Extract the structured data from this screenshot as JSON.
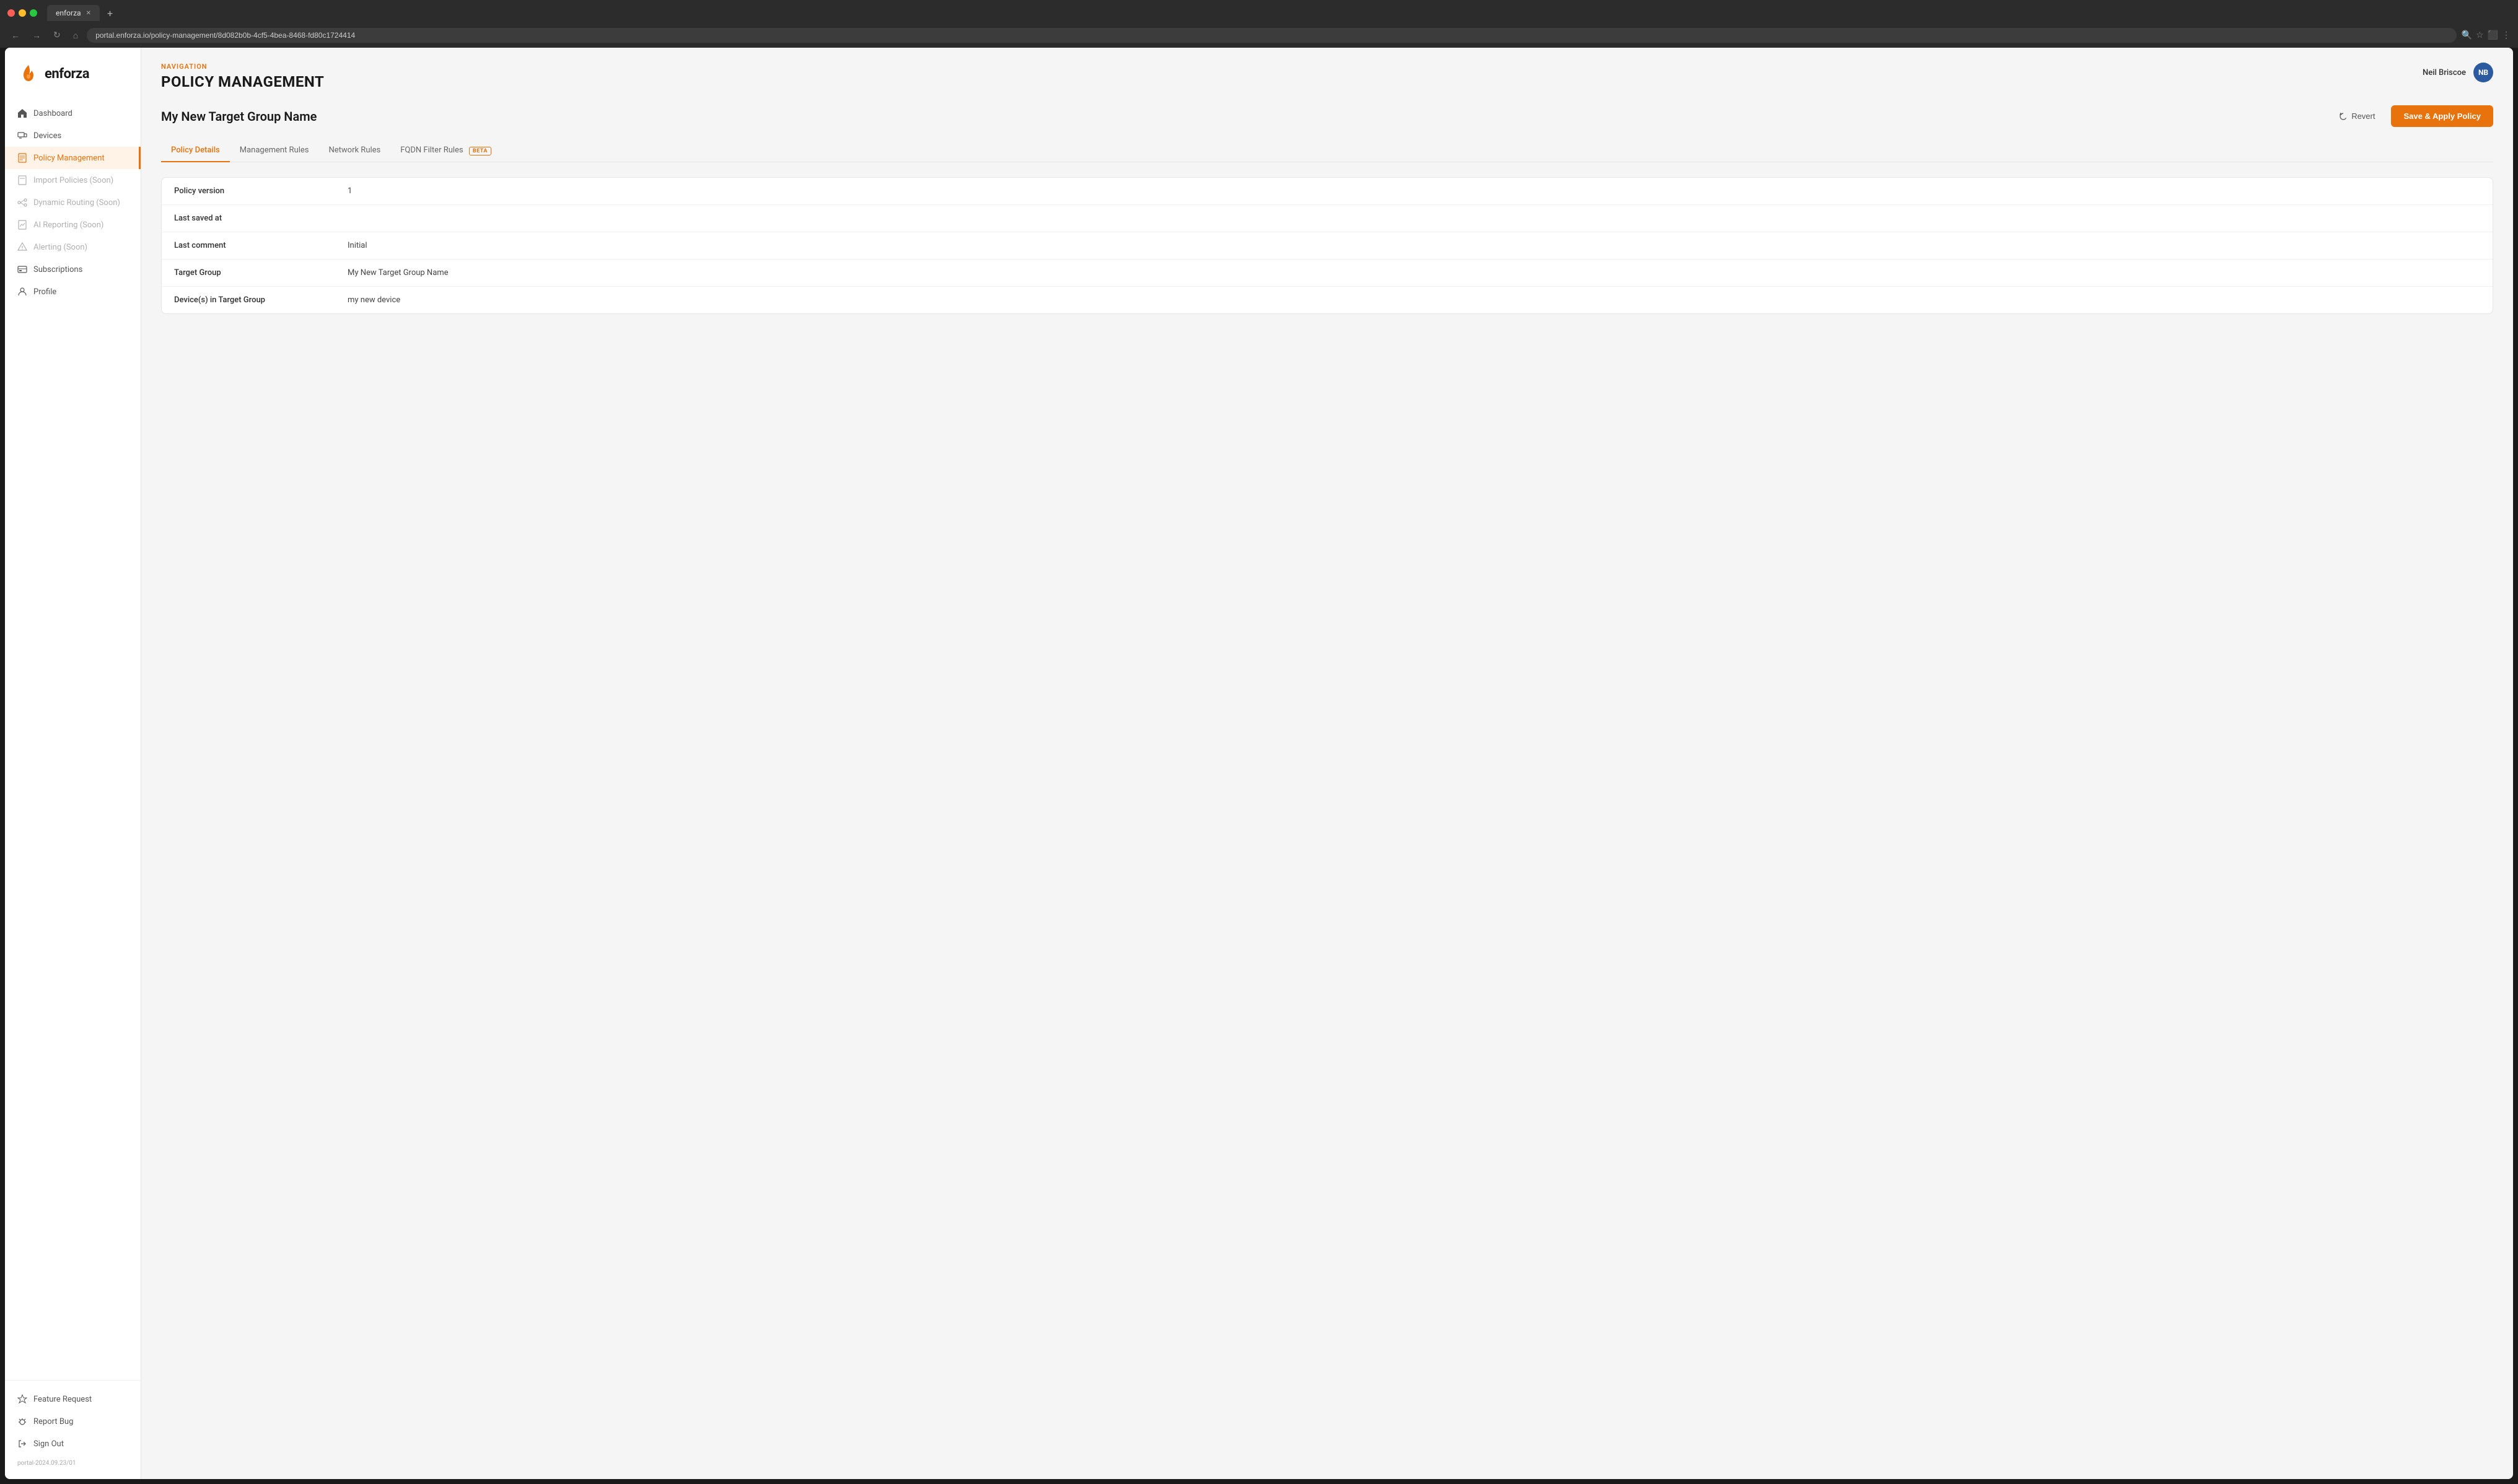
{
  "browser": {
    "tab_title": "enforza",
    "url": "portal.enforza.io/policy-management/8d082b0b-4cf5-4bea-8468-fd80c1724414"
  },
  "nav_label": "NAVIGATION",
  "page_title": "POLICY MANAGEMENT",
  "user": {
    "name": "Neil Briscoe",
    "initials": "NB"
  },
  "content_title": "My New Target Group Name",
  "actions": {
    "revert": "Revert",
    "save": "Save & Apply Policy"
  },
  "tabs": [
    {
      "label": "Policy Details",
      "active": true,
      "beta": false
    },
    {
      "label": "Management Rules",
      "active": false,
      "beta": false
    },
    {
      "label": "Network Rules",
      "active": false,
      "beta": false
    },
    {
      "label": "FQDN Filter Rules",
      "active": false,
      "beta": true
    }
  ],
  "policy_details": {
    "rows": [
      {
        "label": "Policy version",
        "value": "1"
      },
      {
        "label": "Last saved at",
        "value": ""
      },
      {
        "label": "Last comment",
        "value": "Initial"
      },
      {
        "label": "Target Group",
        "value": "My New Target Group Name"
      },
      {
        "label": "Device(s) in Target Group",
        "value": "my new device"
      }
    ]
  },
  "sidebar": {
    "logo_text": "enforza",
    "nav_items": [
      {
        "label": "Dashboard",
        "id": "dashboard",
        "active": false,
        "disabled": false
      },
      {
        "label": "Devices",
        "id": "devices",
        "active": false,
        "disabled": false
      },
      {
        "label": "Policy Management",
        "id": "policy-management",
        "active": true,
        "disabled": false
      },
      {
        "label": "Import Policies (Soon)",
        "id": "import-policies",
        "active": false,
        "disabled": true
      },
      {
        "label": "Dynamic Routing (Soon)",
        "id": "dynamic-routing",
        "active": false,
        "disabled": true
      },
      {
        "label": "AI Reporting (Soon)",
        "id": "ai-reporting",
        "active": false,
        "disabled": true
      },
      {
        "label": "Alerting (Soon)",
        "id": "alerting",
        "active": false,
        "disabled": true
      },
      {
        "label": "Subscriptions",
        "id": "subscriptions",
        "active": false,
        "disabled": false
      },
      {
        "label": "Profile",
        "id": "profile",
        "active": false,
        "disabled": false
      }
    ],
    "bottom_items": [
      {
        "label": "Feature Request",
        "id": "feature-request"
      },
      {
        "label": "Report Bug",
        "id": "report-bug"
      },
      {
        "label": "Sign Out",
        "id": "sign-out"
      }
    ],
    "version": "portal-2024.09.23/01"
  }
}
